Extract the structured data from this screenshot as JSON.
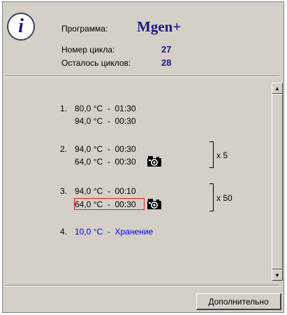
{
  "header": {
    "program_label": "Программа:",
    "program_name": "Mgen+",
    "cycle_number_label": "Номер цикла:",
    "cycle_number_value": "27",
    "cycles_left_label": "Осталось циклов:",
    "cycles_left_value": "28"
  },
  "steps": [
    {
      "number": "1.",
      "lines": [
        "80,0 °C  -  01:30",
        "94,0 °C  -  00:30"
      ],
      "multiplier": ""
    },
    {
      "number": "2.",
      "lines": [
        "94,0 °C  -  00:30",
        "64,0 °C  -  00:30"
      ],
      "multiplier": "x 5"
    },
    {
      "number": "3.",
      "lines": [
        "94,0 °C  -  00:10",
        "64,0 °C  -  00:30"
      ],
      "multiplier": "x 50"
    },
    {
      "number": "4.",
      "lines": [
        "10,0 °C  -  Хранение"
      ],
      "multiplier": ""
    }
  ],
  "icons": {
    "info": "info-icon",
    "camera": "camera-icon"
  },
  "colors": {
    "accent": "#1a1a7a",
    "storage_text": "#0000ee",
    "highlight_border": "#e02020",
    "panel_bg": "#d4d0c8"
  },
  "buttons": {
    "more_label": "Дополнительно"
  }
}
